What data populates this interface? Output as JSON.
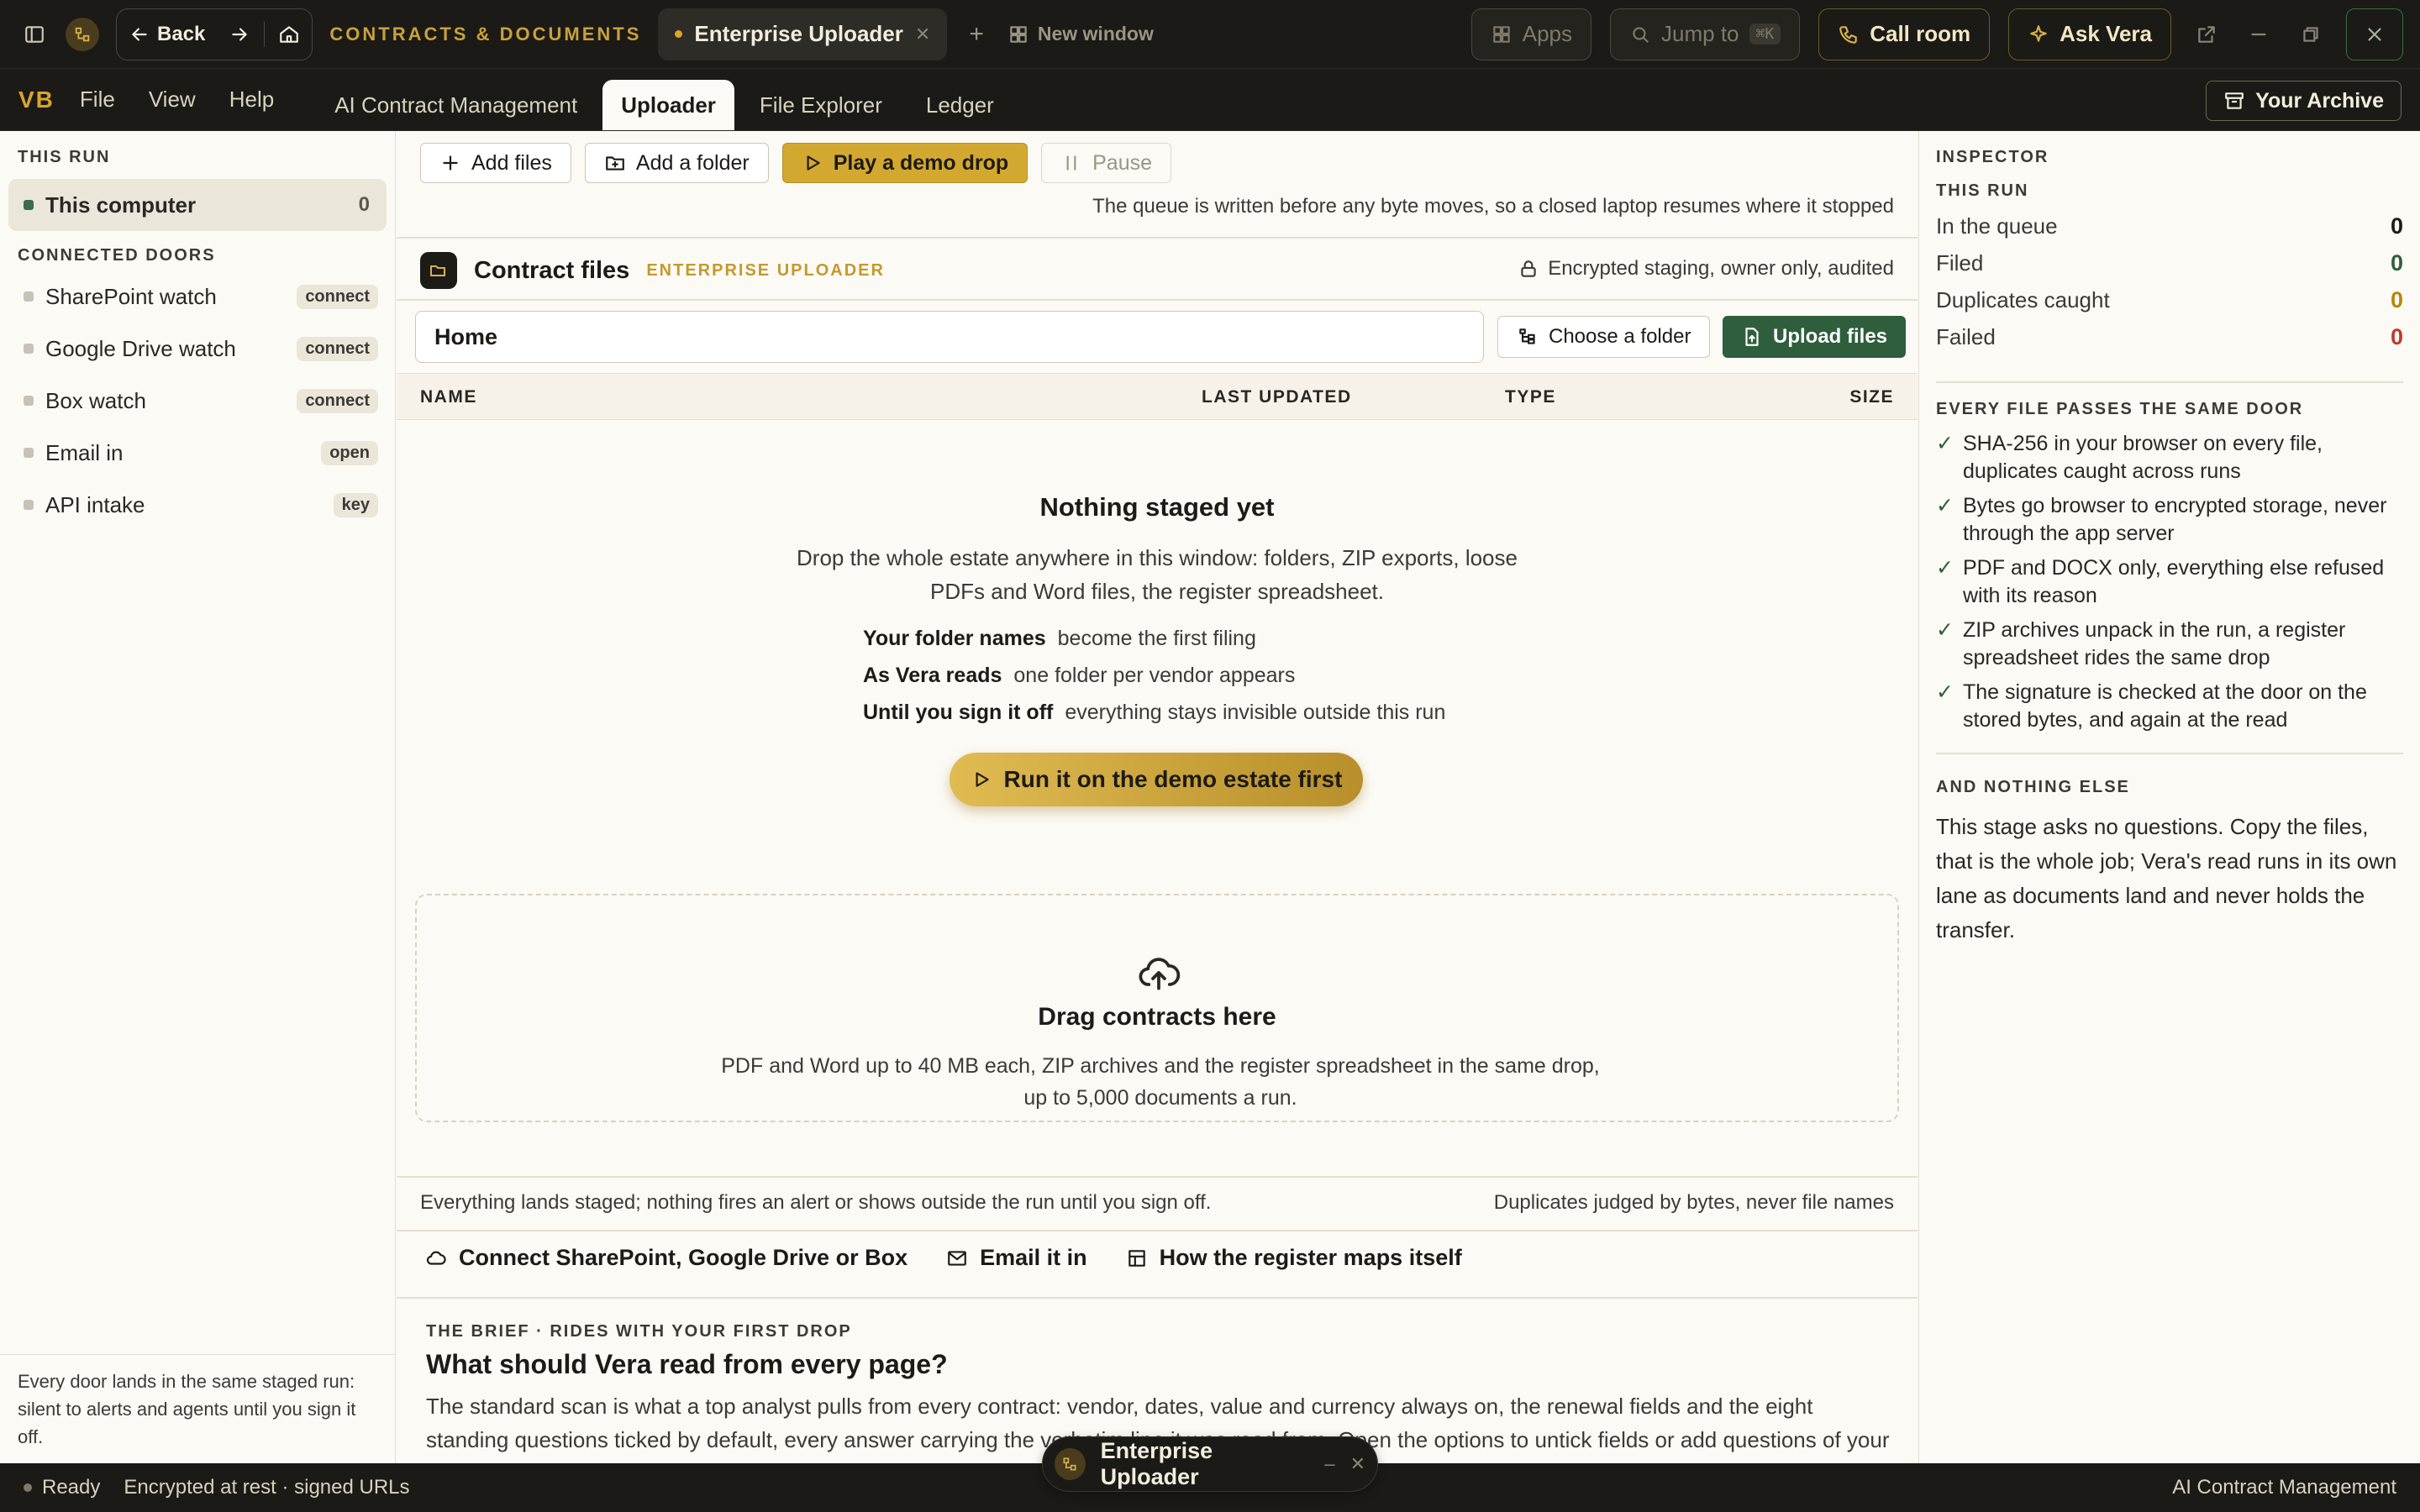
{
  "titlebar": {
    "back_label": "Back",
    "crumb": "CONTRACTS & DOCUMENTS",
    "active_tab": "Enterprise Uploader",
    "new_window": "New window",
    "apps": "Apps",
    "jump_to": "Jump to",
    "jump_shortcut": "⌘K",
    "call_room": "Call room",
    "ask_vera": "Ask Vera"
  },
  "menubar": {
    "brand": "VB",
    "menus": [
      "File",
      "View",
      "Help"
    ],
    "tabs": [
      "AI Contract Management",
      "Uploader",
      "File Explorer",
      "Ledger"
    ],
    "archive": "Your Archive"
  },
  "sidebar": {
    "this_run_heading": "THIS RUN",
    "this_computer": {
      "label": "This computer",
      "count": "0"
    },
    "doors_heading": "CONNECTED DOORS",
    "doors": [
      {
        "label": "SharePoint watch",
        "badge": "connect"
      },
      {
        "label": "Google Drive watch",
        "badge": "connect"
      },
      {
        "label": "Box watch",
        "badge": "connect"
      },
      {
        "label": "Email in",
        "badge": "open"
      },
      {
        "label": "API intake",
        "badge": "key"
      }
    ],
    "footer": "Every door lands in the same staged run: silent to alerts and agents until you sign it off."
  },
  "toolbar": {
    "add_files": "Add files",
    "add_folder": "Add a folder",
    "demo_drop": "Play a demo drop",
    "pause": "Pause",
    "queue_note": "The queue is written before any byte moves, so a closed laptop resumes where it stopped"
  },
  "contract_files": {
    "title": "Contract files",
    "tag": "ENTERPRISE UPLOADER",
    "encryption": "Encrypted staging, owner only, audited",
    "path": "Home",
    "choose_folder": "Choose a folder",
    "upload_files": "Upload files",
    "columns": [
      "NAME",
      "LAST UPDATED",
      "TYPE",
      "SIZE"
    ]
  },
  "empty": {
    "title": "Nothing staged yet",
    "subtitle": "Drop the whole estate anywhere in this window: folders, ZIP exports, loose PDFs and Word files, the register spreadsheet.",
    "rows": [
      {
        "k": "Your folder names",
        "v": "become the first filing"
      },
      {
        "k": "As Vera reads",
        "v": "one folder per vendor appears"
      },
      {
        "k": "Until you sign it off",
        "v": "everything stays invisible outside this run"
      }
    ],
    "cta": "Run it on the demo estate first"
  },
  "dropzone": {
    "title": "Drag contracts here",
    "subtitle": "PDF and Word up to 40 MB each, ZIP archives and the register spreadsheet in the same drop, up to 5,000 documents a run."
  },
  "footer_notes": {
    "left": "Everything lands staged; nothing fires an alert or shows outside the run until you sign off.",
    "right": "Duplicates judged by bytes, never file names"
  },
  "links": [
    "Connect SharePoint, Google Drive or Box",
    "Email it in",
    "How the register maps itself"
  ],
  "brief": {
    "kicker": "THE BRIEF · RIDES WITH YOUR FIRST DROP",
    "title": "What should Vera read from every page?",
    "body": "The standard scan is what a top analyst pulls from every contract: vendor, dates, value and currency always on, the renewal fields and the eight standing questions ticked by default, every answer carrying the verbatim line it was read from. Open the options to untick fields or add questions of your own, then lock it in with your first drop."
  },
  "inspector": {
    "heading": "INSPECTOR",
    "run_heading": "THIS RUN",
    "stats": [
      {
        "label": "In the queue",
        "value": "0",
        "color": "#1d1b16"
      },
      {
        "label": "Filed",
        "value": "0",
        "color": "#2f5e3d"
      },
      {
        "label": "Duplicates caught",
        "value": "0",
        "color": "#b8860b"
      },
      {
        "label": "Failed",
        "value": "0",
        "color": "#c0392b"
      }
    ],
    "door_heading": "EVERY FILE PASSES THE SAME DOOR",
    "checks": [
      "SHA-256 in your browser on every file, duplicates caught across runs",
      "Bytes go browser to encrypted storage, never through the app server",
      "PDF and DOCX only, everything else refused with its reason",
      "ZIP archives unpack in the run, a register spreadsheet rides the same drop",
      "The signature is checked at the door on the stored bytes, and again at the read"
    ],
    "nothing_heading": "AND NOTHING ELSE",
    "nothing_body": "This stage asks no questions. Copy the files, that is the whole job; Vera's read runs in its own lane as documents land and never holds the transfer."
  },
  "statusbar": {
    "ready": "Ready",
    "encryption": "Encrypted at rest · signed URLs",
    "right": "AI Contract Management"
  },
  "floating": {
    "label": "Enterprise Uploader"
  }
}
